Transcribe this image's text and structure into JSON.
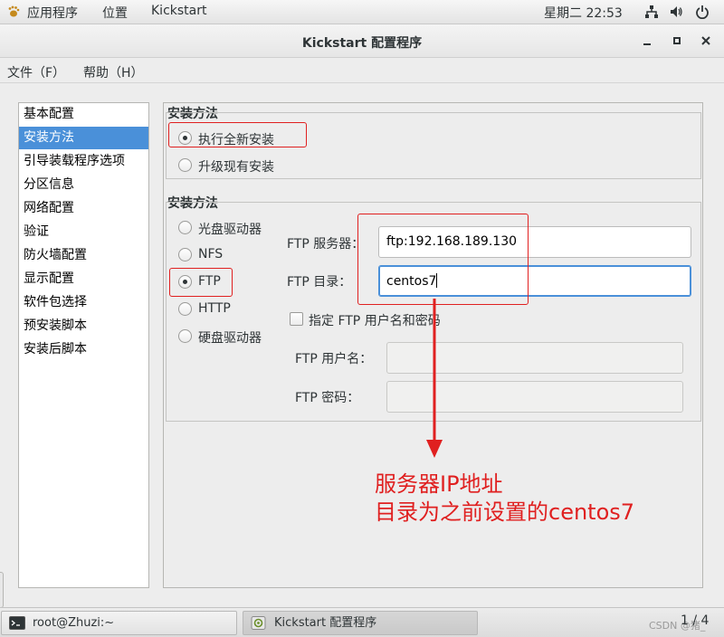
{
  "topbar": {
    "apps_label": "应用程序",
    "places_label": "位置",
    "kickstart_label": "Kickstart",
    "clock": "星期二 22:53"
  },
  "window": {
    "title": "Kickstart 配置程序"
  },
  "menubar": {
    "file": "文件（F）",
    "help": "帮助（H）"
  },
  "sidebar": {
    "items": [
      {
        "label": "基本配置"
      },
      {
        "label": "安装方法"
      },
      {
        "label": "引导装载程序选项"
      },
      {
        "label": "分区信息"
      },
      {
        "label": "网络配置"
      },
      {
        "label": "验证"
      },
      {
        "label": "防火墙配置"
      },
      {
        "label": "显示配置"
      },
      {
        "label": "软件包选择"
      },
      {
        "label": "预安装脚本"
      },
      {
        "label": "安装后脚本"
      }
    ],
    "selected": "安装方法"
  },
  "install_type": {
    "title": "安装方法",
    "options": [
      {
        "label": "执行全新安装",
        "selected": true
      },
      {
        "label": "升级现有安装",
        "selected": false
      }
    ]
  },
  "install_method": {
    "title": "安装方法",
    "options": [
      {
        "label": "光盘驱动器",
        "selected": false
      },
      {
        "label": "NFS",
        "selected": false
      },
      {
        "label": "FTP",
        "selected": true
      },
      {
        "label": "HTTP",
        "selected": false
      },
      {
        "label": "硬盘驱动器",
        "selected": false
      }
    ],
    "ftp_server_label": "FTP 服务器：",
    "ftp_server_value": "ftp:192.168.189.130",
    "ftp_dir_label": "FTP 目录：",
    "ftp_dir_value": "centos7",
    "credentials_checkbox_label": "指定  FTP 用户名和密码",
    "credentials_checked": false,
    "ftp_user_label": "FTP 用户名：",
    "ftp_user_value": "",
    "ftp_password_label": "FTP 密码：",
    "ftp_password_value": ""
  },
  "annotation": {
    "line1": "服务器IP地址",
    "line2": "目录为之前设置的centos7",
    "color": "#e02020"
  },
  "taskbar": {
    "terminal_task": "root@Zhuzi:~",
    "kickstart_task": "Kickstart 配置程序",
    "watermark": "CSDN @猪_",
    "workspace": "1 / 4"
  },
  "colors": {
    "selection": "#4a90d9",
    "annotation_red": "#e02020"
  }
}
